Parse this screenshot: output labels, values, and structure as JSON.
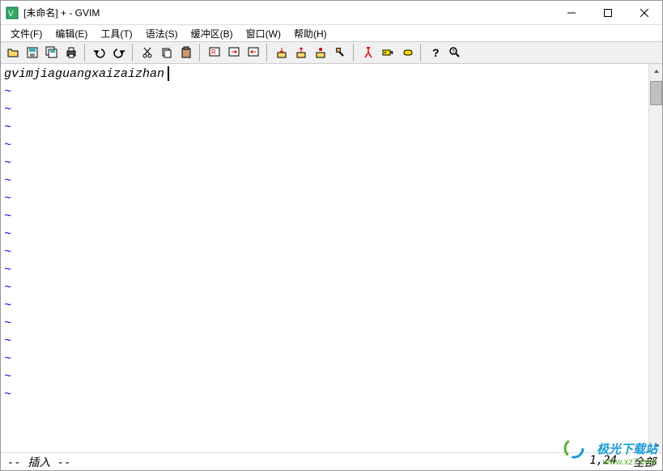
{
  "titlebar": {
    "title": "[未命名] + - GVIM"
  },
  "menubar": {
    "items": [
      "文件(F)",
      "编辑(E)",
      "工具(T)",
      "语法(S)",
      "缓冲区(B)",
      "窗口(W)",
      "帮助(H)"
    ]
  },
  "toolbar": {
    "buttons": [
      "open",
      "save",
      "saveall",
      "print",
      "sep",
      "undo",
      "redo",
      "sep",
      "cut",
      "copy",
      "paste",
      "sep",
      "find",
      "findnext",
      "findprev",
      "sep",
      "load",
      "session",
      "script",
      "make",
      "sep",
      "tags",
      "tagsjump",
      "tagsback",
      "sep",
      "help",
      "findhelp"
    ]
  },
  "editor": {
    "line1": "gvimjiaguangxaizaizhan",
    "tilde": "~",
    "empty_lines": 18
  },
  "statusbar": {
    "mode": "-- 插入 --",
    "position": "1,24",
    "percent": "全部"
  },
  "watermark": {
    "text1": "极光下载站",
    "text2": "www.xz7.com"
  }
}
